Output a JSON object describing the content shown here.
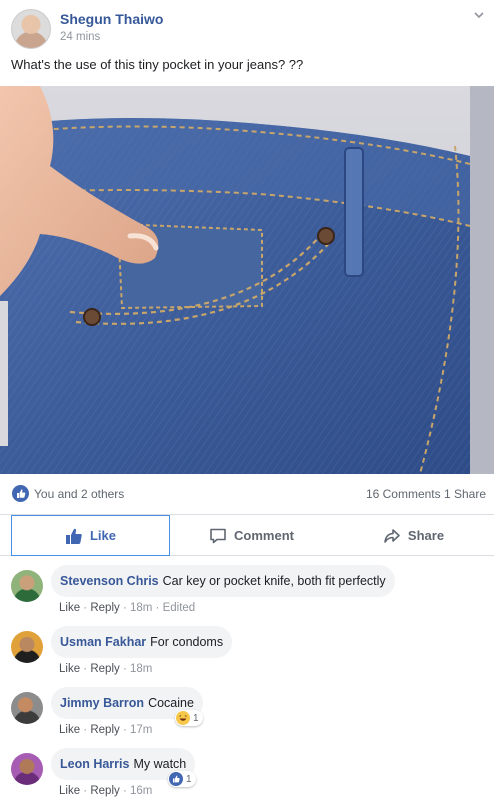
{
  "post": {
    "author": "Shegun Thaiwo",
    "time": "24 mins",
    "text": "What's the use of this tiny pocket in your jeans? ??"
  },
  "stats": {
    "likers": "You and 2 others",
    "comments_shares": "16 Comments  1 Share"
  },
  "actions": {
    "like": "Like",
    "comment": "Comment",
    "share": "Share"
  },
  "comments": [
    {
      "name": "Stevenson Chris",
      "text": "Car key or pocket knife, both fit perfectly",
      "like": "Like",
      "reply": "Reply",
      "time": "18m",
      "edited": "Edited",
      "reaction_count": ""
    },
    {
      "name": "Usman Fakhar",
      "text": "For condoms",
      "like": "Like",
      "reply": "Reply",
      "time": "18m",
      "edited": "",
      "reaction_count": ""
    },
    {
      "name": "Jimmy Barron",
      "text": "Cocaine",
      "like": "Like",
      "reply": "Reply",
      "time": "17m",
      "edited": "",
      "reaction_count": "1"
    },
    {
      "name": "Leon Harris",
      "text": "My watch",
      "like": "Like",
      "reply": "Reply",
      "time": "16m",
      "edited": "",
      "reaction_count": "1"
    }
  ],
  "colors": {
    "brand_blue": "#4267b2",
    "name_blue": "#385898",
    "muted": "#90949c",
    "bubble": "#f2f3f5",
    "denim": "#3b5fa0"
  },
  "icons": {
    "post_menu": "chevron-down-icon",
    "like": "thumbs-up-icon",
    "comment": "speech-bubble-icon",
    "share": "share-arrow-icon",
    "haha": "laughing-emoji-icon",
    "like_reaction": "like-reaction-icon"
  }
}
